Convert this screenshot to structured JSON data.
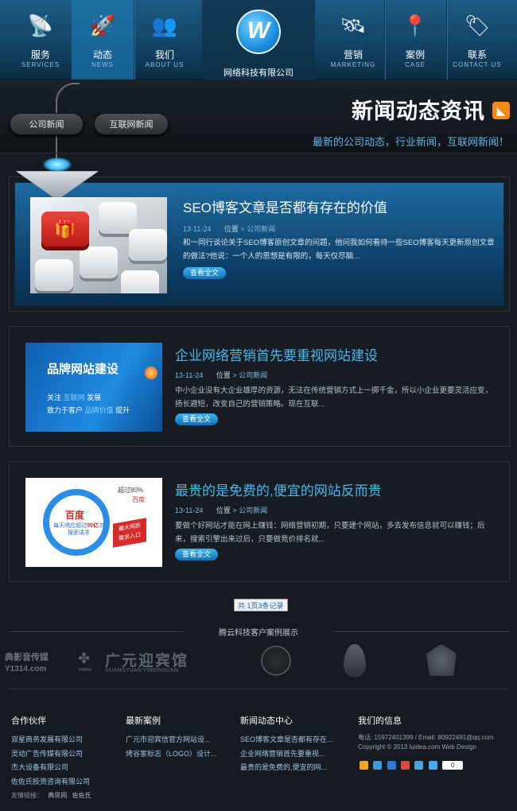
{
  "nav": {
    "items": [
      {
        "cn": "服务",
        "en": "SERVICES",
        "icon": "satellite-icon"
      },
      {
        "cn": "动态",
        "en": "NEWS",
        "icon": "rocket-icon",
        "active": true
      },
      {
        "cn": "我们",
        "en": "ABOUT US",
        "icon": "people-icon"
      },
      {
        "cn": "营销",
        "en": "MARKETING",
        "icon": "satellite-orbit-icon"
      },
      {
        "cn": "案例",
        "en": "CASE",
        "icon": "map-pin-icon"
      },
      {
        "cn": "联系",
        "en": "CONTACT US",
        "icon": "tag-icon"
      }
    ],
    "logo_text": "网络科技有限公司",
    "logo_letter": "W"
  },
  "subhead": {
    "buttons": [
      "公司新闻",
      "互联网新闻"
    ],
    "title": "新闻动态资讯",
    "tagline": "最新的公司动态，行业新闻，互联网新闻！"
  },
  "news": [
    {
      "title": "SEO博客文章是否都有存在的价值",
      "date": "13-11-24",
      "pos": "位置",
      "sep": ">",
      "cat": "公司新闻",
      "excerpt": "和一同行谈论关于SEO博客原创文章的问题，他问我如何看待一些SEO博客每天更新原创文章的做法?他说：一个人的思想是有限的，每天仅尽脑...",
      "more": "查看全文"
    },
    {
      "title": "企业网络营销首先要重视网站建设",
      "date": "13-11-24",
      "pos": "位置",
      "sep": ">",
      "cat": "公司新闻",
      "excerpt": "中小企业没有大企业雄厚的资源，无法在传统营销方式上一掷千金，所以小企业更要灵活应变，扬长避短，改变自己的营销策略。现在互联...",
      "more": "查看全文",
      "thumb": {
        "l1": "品牌网站建设",
        "l2a": "关注",
        "l2b": "互联网",
        "l2c": "发展",
        "l3a": "致力于客户",
        "l3b": "品牌价值",
        "l3c": "提升"
      }
    },
    {
      "title": "最贵的是免费的,便宜的网站反而贵",
      "date": "13-11-24",
      "pos": "位置",
      "sep": ">",
      "cat": "公司新闻",
      "excerpt": "要做个好网站才能在网上赚钱：网络营销初期，只要建个网站，多去发布信息就可以赚钱；后来，搜索引擎出来过后，只要做竞价排名就...",
      "more": "查看全文",
      "thumb": {
        "baidu": "百度",
        "line1": "每天响应超过",
        "num": "50亿",
        "unit": "次",
        "line2": "搜索请求",
        "pct": "超过80%",
        "pct2": "百度",
        "badge1": "最大网民",
        "badge2": "需求入口"
      }
    }
  ],
  "pager": "共 1页3条记录",
  "partners": {
    "title": "腾云科技客户案例展示",
    "logos": [
      "典影音传媒",
      "Y1314.com",
      "广元迎宾馆",
      "GUANGYUAN YINBINGUAN",
      "YINBIN"
    ]
  },
  "footer": {
    "cols": [
      {
        "title": "合作伙伴",
        "links": [
          "双星商务发展有限公司",
          "灵动广告传媒有限公司",
          "杰大设备有限公司",
          "佐佐氏投资咨询有限公司"
        ]
      },
      {
        "title": "最新案例",
        "links": [
          "广元市迎宾信官方网站设...",
          "烤谷家标志（LOGO）设计..."
        ]
      },
      {
        "title": "新闻动态中心",
        "links": [
          "SEO博客文章是否都有存在...",
          "企业网络营销首先要重视...",
          "最贵的是免费的,便宜的网..."
        ]
      },
      {
        "title": "我们的信息",
        "phone": "电话: 15972401399 / Email: 80922491@qq.com",
        "copy": "Copyright © 2013  luidea.com  Web Design"
      }
    ],
    "share_count": "0",
    "friend_label": "友情链接：",
    "friend_links": [
      "典思网",
      "佐佐氏"
    ]
  }
}
